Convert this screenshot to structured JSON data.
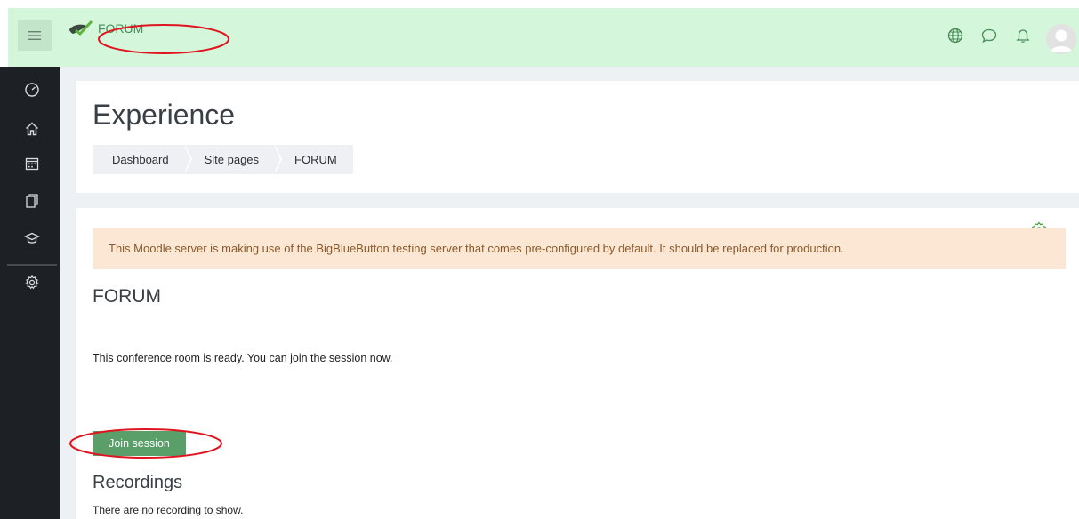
{
  "topbar": {
    "brand_label": "FORUM",
    "icons": [
      "hamburger-icon",
      "logo-icon",
      "language-icon",
      "messages-icon",
      "notifications-icon",
      "user-avatar-icon"
    ]
  },
  "drawer": {
    "items": [
      {
        "icon": "dashboard-icon"
      },
      {
        "icon": "home-icon"
      },
      {
        "icon": "calendar-icon"
      },
      {
        "icon": "files-icon"
      },
      {
        "icon": "courses-icon"
      },
      {
        "icon": "settings-icon"
      }
    ]
  },
  "header": {
    "title": "Experience",
    "breadcrumb": [
      "Dashboard",
      "Site pages",
      "FORUM"
    ]
  },
  "alert": {
    "text": "This Moodle server is making use of the BigBlueButton testing server that comes pre-configured by default. It should be replaced for production."
  },
  "main": {
    "section_title": "FORUM",
    "status_text": "This conference room is ready. You can join the session now.",
    "join_button_label": "Join session",
    "recordings_title": "Recordings",
    "recordings_text": "There are no recording to show."
  },
  "colors": {
    "topbar_bg": "#d4f7dc",
    "drawer_bg": "#1d2125",
    "accent_green": "#5a9e6a",
    "alert_bg": "#fbe7d3",
    "annotation_red": "#e0141e"
  }
}
